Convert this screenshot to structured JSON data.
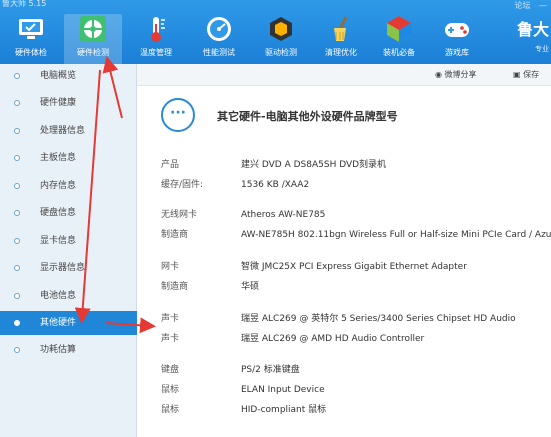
{
  "app": {
    "title": "鲁大师 5.15",
    "window_controls": [
      "论坛",
      "—"
    ],
    "brand": "鲁大",
    "brand_sub": "专业"
  },
  "toolbar": [
    {
      "label": "硬件体检",
      "icon": "monitor-check-icon",
      "active": false
    },
    {
      "label": "硬件检测",
      "icon": "chip-fan-icon",
      "active": true
    },
    {
      "label": "温度管理",
      "icon": "thermometer-icon",
      "active": false
    },
    {
      "label": "性能测试",
      "icon": "speedometer-icon",
      "active": false
    },
    {
      "label": "驱动检测",
      "icon": "driver-box-icon",
      "active": false
    },
    {
      "label": "清理优化",
      "icon": "broom-icon",
      "active": false
    },
    {
      "label": "装机必备",
      "icon": "install-cube-icon",
      "active": false
    },
    {
      "label": "游戏库",
      "icon": "gamepad-icon",
      "active": false
    }
  ],
  "subbar": {
    "weibo_share": "微博分享",
    "save": "保存"
  },
  "sidebar": {
    "items": [
      {
        "label": "电脑概览",
        "active": false
      },
      {
        "label": "硬件健康",
        "active": false
      },
      {
        "label": "处理器信息",
        "active": false
      },
      {
        "label": "主板信息",
        "active": false
      },
      {
        "label": "内存信息",
        "active": false
      },
      {
        "label": "硬盘信息",
        "active": false
      },
      {
        "label": "显卡信息",
        "active": false
      },
      {
        "label": "显示器信息",
        "active": false
      },
      {
        "label": "电池信息",
        "active": false
      },
      {
        "label": "其他硬件",
        "active": true
      },
      {
        "label": "功耗估算",
        "active": false
      }
    ]
  },
  "main": {
    "header_icon": "···",
    "title": "其它硬件-电脑其他外设硬件品牌型号",
    "rows": [
      {
        "k": "产品",
        "v": "建兴 DVD A DS8A5SH DVD刻录机"
      },
      {
        "k": "缓存/固件:",
        "v": "1536 KB /XAA2"
      },
      {
        "k": "无线网卡",
        "v": "Atheros AW-NE785"
      },
      {
        "k": "制造商",
        "v": "AW-NE785H 802.11bgn Wireless Full or Half-size Mini PCIe Card / Azur"
      },
      {
        "k": "网卡",
        "v": "智微 JMC25X PCI Express Gigabit Ethernet Adapter"
      },
      {
        "k": "制造商",
        "v": "华硕"
      },
      {
        "k": "声卡",
        "v": "瑞昱 ALC269 @ 英特尔 5 Series/3400 Series Chipset HD Audio"
      },
      {
        "k": "声卡",
        "v": "瑞昱 ALC269 @ AMD HD Audio Controller"
      },
      {
        "k": "键盘",
        "v": "PS/2 标准键盘"
      },
      {
        "k": "鼠标",
        "v": "ELAN Input Device"
      },
      {
        "k": "鼠标",
        "v": "HID-compliant 鼠标"
      }
    ]
  },
  "colors": {
    "toolbar": "#1f86d8",
    "sidebar_active": "#1f86d8",
    "arrow": "#e53935"
  }
}
